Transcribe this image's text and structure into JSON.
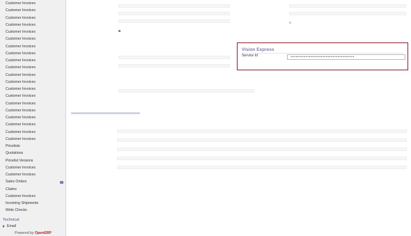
{
  "sidebar": {
    "items": [
      "Customer Invoices",
      "Customer Invoices",
      "Customer Invoices",
      "Customer Invoices",
      "Customer Invoices",
      "Customer Invoices",
      "Customer Invoices",
      "Customer Invoices",
      "Customer Invoices",
      "Customer Invoices",
      "Customer Invoices",
      "Customer Invoices",
      "Customer Invoices",
      "Customer Invoices",
      "Customer Invoices",
      "Customer Invoices",
      "Customer Invoices",
      "Customer Invoices",
      "Customer Invoices",
      "Customer Invoices",
      "Pricelists",
      "Quotations",
      "Pricelist Versions",
      "Customer Invoices",
      "Customer Invoices",
      "Sales Orders",
      "Claims",
      "Customer Invoices",
      "Incoming Shipments",
      "Write Checks"
    ],
    "section_heading": "Technical",
    "email_item": "Email",
    "powered_prefix": "Powered by ",
    "powered_brand": "OpenERP"
  },
  "vision_express": {
    "title": "Vision Express",
    "service_id_label": "Service Id",
    "service_id_value": "••••••••••••••••••••••••••••••••••••••"
  },
  "colors": {
    "accent": "#7c7bad",
    "highlight_border": "#8a1f2e",
    "brand": "#c11a1a"
  }
}
